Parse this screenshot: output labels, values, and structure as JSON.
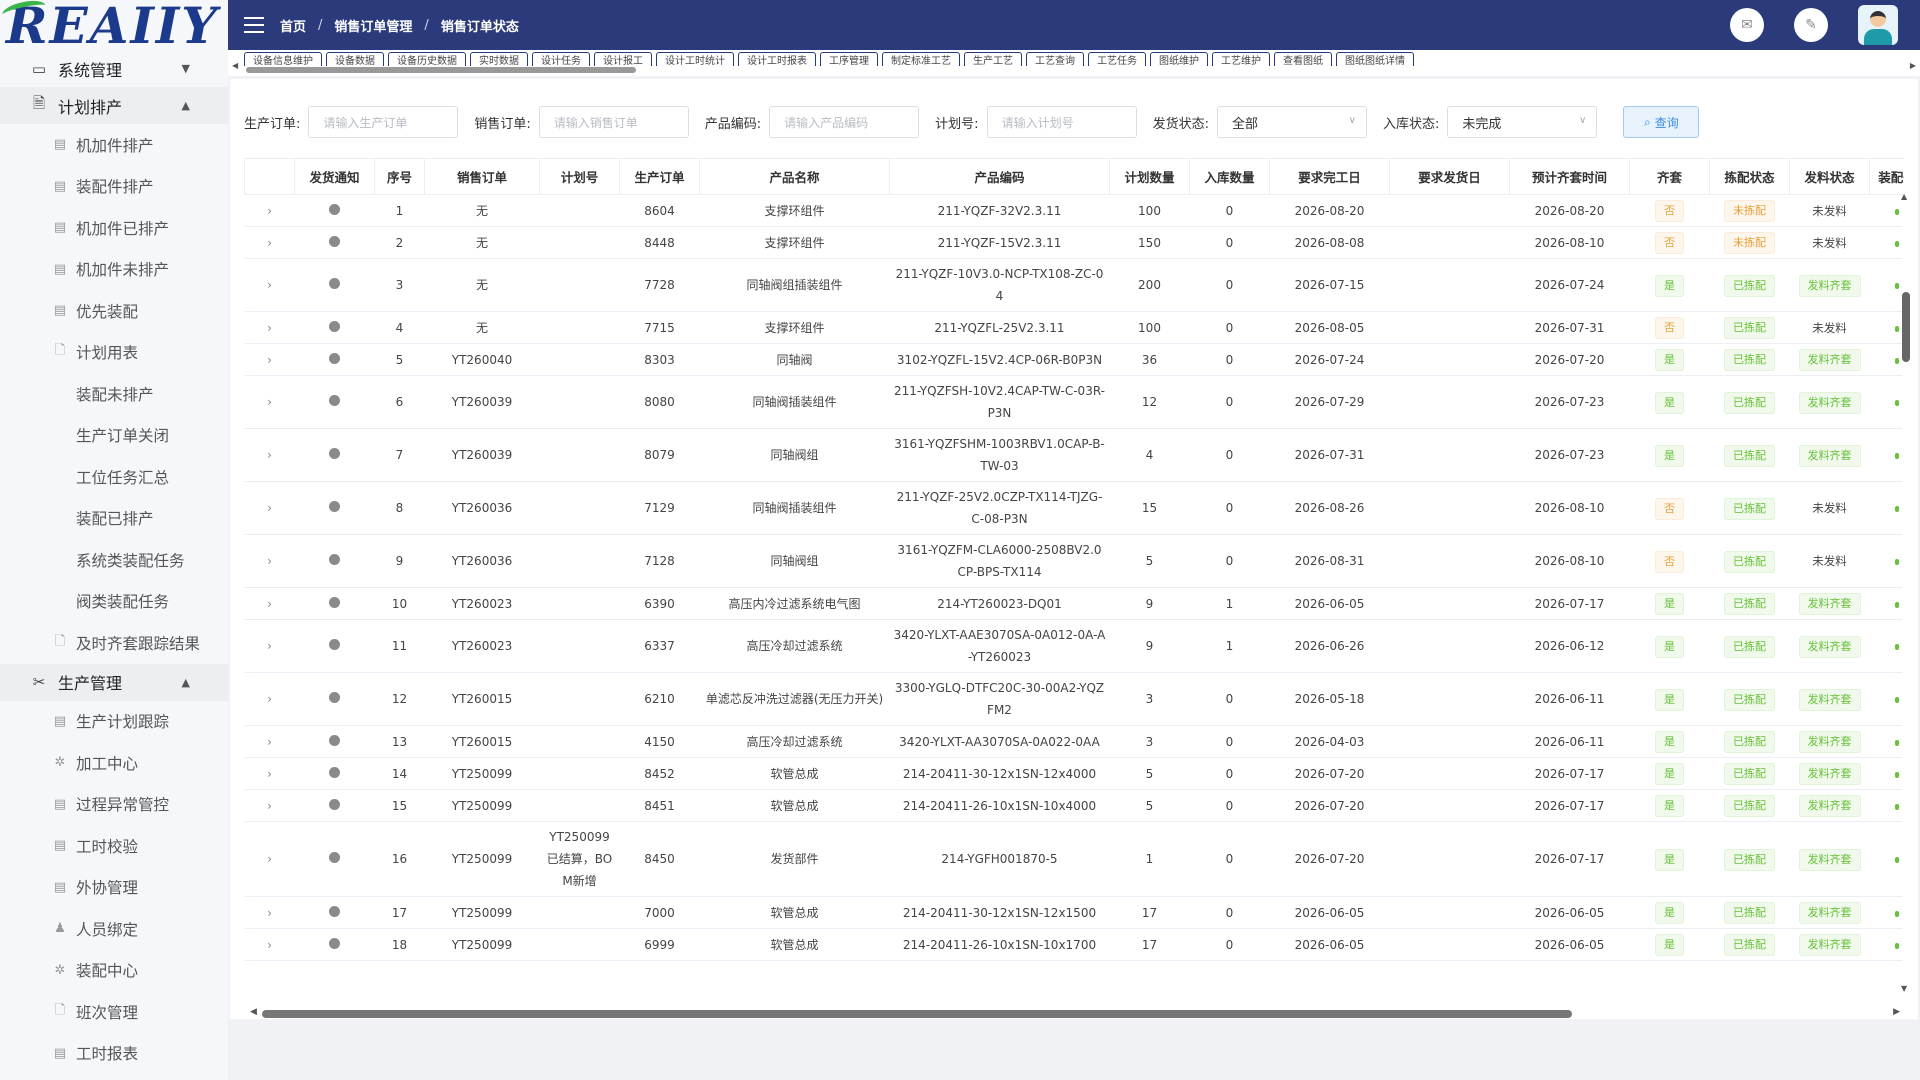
{
  "logo": "REAIIY",
  "sidebar": {
    "groups": [
      {
        "label": "系统管理",
        "arrow": "▼",
        "items": []
      },
      {
        "label": "计划排产",
        "arrow": "▲",
        "items": [
          {
            "label": "机加件排产",
            "icon": "doc"
          },
          {
            "label": "装配件排产",
            "icon": "doc"
          },
          {
            "label": "机加件已排产",
            "icon": "doc"
          },
          {
            "label": "机加件未排产",
            "icon": "doc"
          },
          {
            "label": "优先装配",
            "icon": "doc"
          },
          {
            "label": "计划用表",
            "icon": "file"
          },
          {
            "label": "装配未排产",
            "icon": ""
          },
          {
            "label": "生产订单关闭",
            "icon": ""
          },
          {
            "label": "工位任务汇总",
            "icon": ""
          },
          {
            "label": "装配已排产",
            "icon": ""
          },
          {
            "label": "系统类装配任务",
            "icon": ""
          },
          {
            "label": "阀类装配任务",
            "icon": ""
          },
          {
            "label": "及时齐套跟踪结果",
            "icon": "file"
          }
        ]
      },
      {
        "label": "生产管理",
        "arrow": "▲",
        "items": [
          {
            "label": "生产计划跟踪",
            "icon": "doc"
          },
          {
            "label": "加工中心",
            "icon": "gear"
          },
          {
            "label": "过程异常管控",
            "icon": "doc"
          },
          {
            "label": "工时校验",
            "icon": "doc"
          },
          {
            "label": "外协管理",
            "icon": "doc"
          },
          {
            "label": "人员绑定",
            "icon": "user"
          },
          {
            "label": "装配中心",
            "icon": "gear"
          },
          {
            "label": "班次管理",
            "icon": "file"
          },
          {
            "label": "工时报表",
            "icon": "doc"
          }
        ]
      }
    ]
  },
  "breadcrumb": [
    "首页",
    "销售订单管理",
    "销售订单状态"
  ],
  "tabs": [
    "设备信息维护",
    "设备数据",
    "设备历史数据",
    "实时数据",
    "设计任务",
    "设计报工",
    "设计工时统计",
    "设计工时报表",
    "工序管理",
    "制定标准工艺",
    "生产工艺",
    "工艺查询",
    "工艺任务",
    "图纸维护",
    "工艺维护",
    "查看图纸",
    "图纸图纸详情"
  ],
  "filters": {
    "production_order": {
      "label": "生产订单:",
      "placeholder": "请输入生产订单"
    },
    "sales_order": {
      "label": "销售订单:",
      "placeholder": "请输入销售订单"
    },
    "product_code": {
      "label": "产品编码:",
      "placeholder": "请输入产品编码"
    },
    "plan_no": {
      "label": "计划号:",
      "placeholder": "请输入计划号"
    },
    "ship_status": {
      "label": "发货状态:",
      "value": "全部"
    },
    "stock_status": {
      "label": "入库状态:",
      "value": "未完成"
    },
    "query_label": "查询"
  },
  "table": {
    "headers": [
      "",
      "发货通知",
      "序号",
      "销售订单",
      "计划号",
      "生产订单",
      "产品名称",
      "产品编码",
      "计划数量",
      "入库数量",
      "要求完工日",
      "要求发货日",
      "预计齐套时间",
      "齐套",
      "拣配状态",
      "发料状态",
      "装配开"
    ],
    "rows": [
      {
        "seq": "1",
        "sales": "无",
        "plan": "",
        "prod": "8604",
        "name": "支撑环组件",
        "code": "211-YQZF-32V2.3.11",
        "qty": "100",
        "stock": "0",
        "finish": "2026-08-20",
        "ship": "",
        "eta": "2026-08-20",
        "kit": "否",
        "pick": "未拣配",
        "issue": "未发料"
      },
      {
        "seq": "2",
        "sales": "无",
        "plan": "",
        "prod": "8448",
        "name": "支撑环组件",
        "code": "211-YQZF-15V2.3.11",
        "qty": "150",
        "stock": "0",
        "finish": "2026-08-08",
        "ship": "",
        "eta": "2026-08-10",
        "kit": "否",
        "pick": "未拣配",
        "issue": "未发料"
      },
      {
        "seq": "3",
        "sales": "无",
        "plan": "",
        "prod": "7728",
        "name": "同轴阀组插装组件",
        "code": "211-YQZF-10V3.0-NCP-TX108-ZC-04",
        "qty": "200",
        "stock": "0",
        "finish": "2026-07-15",
        "ship": "",
        "eta": "2026-07-24",
        "kit": "是",
        "pick": "已拣配",
        "issue": "发料齐套"
      },
      {
        "seq": "4",
        "sales": "无",
        "plan": "",
        "prod": "7715",
        "name": "支撑环组件",
        "code": "211-YQZFL-25V2.3.11",
        "qty": "100",
        "stock": "0",
        "finish": "2026-08-05",
        "ship": "",
        "eta": "2026-07-31",
        "kit": "否",
        "pick": "已拣配",
        "issue": "未发料"
      },
      {
        "seq": "5",
        "sales": "YT260040",
        "plan": "",
        "prod": "8303",
        "name": "同轴阀",
        "code": "3102-YQZFL-15V2.4CP-06R-B0P3N",
        "qty": "36",
        "stock": "0",
        "finish": "2026-07-24",
        "ship": "",
        "eta": "2026-07-20",
        "kit": "是",
        "pick": "已拣配",
        "issue": "发料齐套"
      },
      {
        "seq": "6",
        "sales": "YT260039",
        "plan": "",
        "prod": "8080",
        "name": "同轴阀插装组件",
        "code": "211-YQZFSH-10V2.4CAP-TW-C-03R-P3N",
        "qty": "12",
        "stock": "0",
        "finish": "2026-07-29",
        "ship": "",
        "eta": "2026-07-23",
        "kit": "是",
        "pick": "已拣配",
        "issue": "发料齐套"
      },
      {
        "seq": "7",
        "sales": "YT260039",
        "plan": "",
        "prod": "8079",
        "name": "同轴阀组",
        "code": "3161-YQZFSHM-1003RBV1.0CAP-B-TW-03",
        "qty": "4",
        "stock": "0",
        "finish": "2026-07-31",
        "ship": "",
        "eta": "2026-07-23",
        "kit": "是",
        "pick": "已拣配",
        "issue": "发料齐套"
      },
      {
        "seq": "8",
        "sales": "YT260036",
        "plan": "",
        "prod": "7129",
        "name": "同轴阀插装组件",
        "code": "211-YQZF-25V2.0CZP-TX114-TJZG-C-08-P3N",
        "qty": "15",
        "stock": "0",
        "finish": "2026-08-26",
        "ship": "",
        "eta": "2026-08-10",
        "kit": "否",
        "pick": "已拣配",
        "issue": "未发料"
      },
      {
        "seq": "9",
        "sales": "YT260036",
        "plan": "",
        "prod": "7128",
        "name": "同轴阀组",
        "code": "3161-YQZFM-CLA6000-2508BV2.0CP-BPS-TX114",
        "qty": "5",
        "stock": "0",
        "finish": "2026-08-31",
        "ship": "",
        "eta": "2026-08-10",
        "kit": "否",
        "pick": "已拣配",
        "issue": "未发料"
      },
      {
        "seq": "10",
        "sales": "YT260023",
        "plan": "",
        "prod": "6390",
        "name": "高压内冷过滤系统电气图",
        "code": "214-YT260023-DQ01",
        "qty": "9",
        "stock": "1",
        "finish": "2026-06-05",
        "ship": "",
        "eta": "2026-07-17",
        "kit": "是",
        "pick": "已拣配",
        "issue": "发料齐套"
      },
      {
        "seq": "11",
        "sales": "YT260023",
        "plan": "",
        "prod": "6337",
        "name": "高压冷却过滤系统",
        "code": "3420-YLXT-AAE3070SA-0A012-0A-A-YT260023",
        "qty": "9",
        "stock": "1",
        "finish": "2026-06-26",
        "ship": "",
        "eta": "2026-06-12",
        "kit": "是",
        "pick": "已拣配",
        "issue": "发料齐套"
      },
      {
        "seq": "12",
        "sales": "YT260015",
        "plan": "",
        "prod": "6210",
        "name": "单滤芯反冲洗过滤器(无压力开关)",
        "code": "3300-YGLQ-DTFC20C-30-00A2-YQZFM2",
        "qty": "3",
        "stock": "0",
        "finish": "2026-05-18",
        "ship": "",
        "eta": "2026-06-11",
        "kit": "是",
        "pick": "已拣配",
        "issue": "发料齐套"
      },
      {
        "seq": "13",
        "sales": "YT260015",
        "plan": "",
        "prod": "4150",
        "name": "高压冷却过滤系统",
        "code": "3420-YLXT-AA3070SA-0A022-0AA",
        "qty": "3",
        "stock": "0",
        "finish": "2026-04-03",
        "ship": "",
        "eta": "2026-06-11",
        "kit": "是",
        "pick": "已拣配",
        "issue": "发料齐套"
      },
      {
        "seq": "14",
        "sales": "YT250099",
        "plan": "",
        "prod": "8452",
        "name": "软管总成",
        "code": "214-20411-30-12x1SN-12x4000",
        "qty": "5",
        "stock": "0",
        "finish": "2026-07-20",
        "ship": "",
        "eta": "2026-07-17",
        "kit": "是",
        "pick": "已拣配",
        "issue": "发料齐套"
      },
      {
        "seq": "15",
        "sales": "YT250099",
        "plan": "",
        "prod": "8451",
        "name": "软管总成",
        "code": "214-20411-26-10x1SN-10x4000",
        "qty": "5",
        "stock": "0",
        "finish": "2026-07-20",
        "ship": "",
        "eta": "2026-07-17",
        "kit": "是",
        "pick": "已拣配",
        "issue": "发料齐套"
      },
      {
        "seq": "16",
        "sales": "YT250099",
        "plan": "YT250099已结算，BOM新增",
        "prod": "8450",
        "name": "发货部件",
        "code": "214-YGFH001870-5",
        "qty": "1",
        "stock": "0",
        "finish": "2026-07-20",
        "ship": "",
        "eta": "2026-07-17",
        "kit": "是",
        "pick": "已拣配",
        "issue": "发料齐套"
      },
      {
        "seq": "17",
        "sales": "YT250099",
        "plan": "",
        "prod": "7000",
        "name": "软管总成",
        "code": "214-20411-30-12x1SN-12x1500",
        "qty": "17",
        "stock": "0",
        "finish": "2026-06-05",
        "ship": "",
        "eta": "2026-06-05",
        "kit": "是",
        "pick": "已拣配",
        "issue": "发料齐套"
      },
      {
        "seq": "18",
        "sales": "YT250099",
        "plan": "",
        "prod": "6999",
        "name": "软管总成",
        "code": "214-20411-26-10x1SN-10x1700",
        "qty": "17",
        "stock": "0",
        "finish": "2026-06-05",
        "ship": "",
        "eta": "2026-06-05",
        "kit": "是",
        "pick": "已拣配",
        "issue": "发料齐套"
      }
    ]
  },
  "colors": {
    "topbar": "#2b3a7a",
    "tag_green": "#67c23a",
    "tag_orange": "#e6a23c",
    "primary": "#3a8ee6"
  }
}
